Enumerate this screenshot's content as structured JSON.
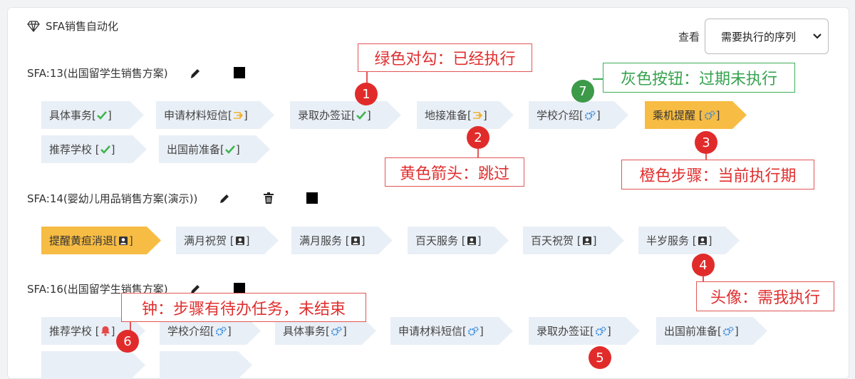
{
  "header": {
    "title": "SFA销售自动化",
    "view_label": "查看",
    "view_select": "需要执行的序列"
  },
  "colors": {
    "step_bg": "#e9eff6",
    "active_bg": "#f7bc43",
    "check": "#3fb54d",
    "skip": "#f2b233",
    "gear": "#3d8edb",
    "callout_red": "#e02f2f",
    "callout_green": "#36a34f"
  },
  "sequences": [
    {
      "title": "SFA:13(出国留学生销售方案)",
      "steps": [
        {
          "label": "具体事务",
          "status": "check-icon"
        },
        {
          "label": "申请材料短信",
          "status": "skip-arrow-icon"
        },
        {
          "label": "录取办签证",
          "status": "check-icon"
        },
        {
          "label": "地接准备",
          "status": "skip-arrow-icon"
        },
        {
          "label": "学校介绍",
          "status": "gear-icon"
        },
        {
          "label": "乘机提醒",
          "status": "gear-icon",
          "active": true
        },
        {
          "label": "推荐学校",
          "status": "check-icon"
        },
        {
          "label": "出国前准备",
          "status": "check-icon"
        }
      ]
    },
    {
      "title": "SFA:14(婴幼儿用品销售方案(演示))",
      "steps": [
        {
          "label": "提醒黄疸消退",
          "status": "user-icon",
          "active": true
        },
        {
          "label": "满月祝贺",
          "status": "user-icon"
        },
        {
          "label": "满月服务",
          "status": "user-icon"
        },
        {
          "label": "百天服务",
          "status": "user-icon"
        },
        {
          "label": "百天祝贺",
          "status": "user-icon"
        },
        {
          "label": "半岁服务",
          "status": "user-icon"
        }
      ]
    },
    {
      "title": "SFA:16(出国留学生销售方案)",
      "steps": [
        {
          "label": "推荐学校",
          "status": "bell-icon"
        },
        {
          "label": "学校介绍",
          "status": "gear-icon"
        },
        {
          "label": "具体事务",
          "status": "gear-icon"
        },
        {
          "label": "申请材料短信",
          "status": "gear-icon"
        },
        {
          "label": "录取办签证",
          "status": "gear-icon"
        },
        {
          "label": "出国前准备",
          "status": "gear-icon"
        }
      ]
    }
  ],
  "callouts": [
    {
      "num": "1",
      "text": "绿色对勾：已经执行"
    },
    {
      "num": "2",
      "text": "黄色箭头：跳过"
    },
    {
      "num": "3",
      "text": "橙色步骤：当前执行期"
    },
    {
      "num": "4",
      "text": "头像：需我执行"
    },
    {
      "num": "5",
      "text": ""
    },
    {
      "num": "6",
      "text": "钟：步骤有待办任务，未结束"
    },
    {
      "num": "7",
      "text": "灰色按钮：过期未执行"
    }
  ]
}
